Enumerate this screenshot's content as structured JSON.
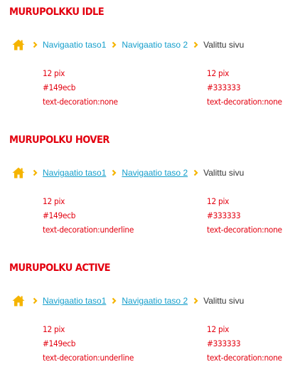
{
  "colors": {
    "title": "#e3000f",
    "link": "#149ecb",
    "current": "#333333",
    "home_icon": "#f5b400",
    "separator": "#f5b400",
    "spec_text": "#e3000f"
  },
  "sections": [
    {
      "title": "MURUPOLKKU IDLE",
      "breadcrumb": {
        "home_icon": "home-icon",
        "separator_icon": "chevron-right-icon",
        "items": [
          "Navigaatio taso1",
          "Navigaatio taso 2"
        ],
        "current": "Valittu sivu"
      },
      "link_spec": [
        "12 pix",
        "#149ecb",
        "text-decoration:none"
      ],
      "current_spec": [
        "12 pix",
        "#333333",
        "text-decoration:none"
      ]
    },
    {
      "title": "MURUPOLKU HOVER",
      "breadcrumb": {
        "home_icon": "home-icon",
        "separator_icon": "chevron-right-icon",
        "items": [
          "Navigaatio taso1",
          "Navigaatio taso 2"
        ],
        "current": "Valittu sivu"
      },
      "link_spec": [
        "12 pix",
        "#149ecb",
        "text-decoration:underline"
      ],
      "current_spec": [
        "12 pix",
        "#333333",
        "text-decoration:none"
      ]
    },
    {
      "title": "MURUPOLKU ACTIVE",
      "breadcrumb": {
        "home_icon": "home-icon",
        "separator_icon": "chevron-right-icon",
        "items": [
          "Navigaatio taso1",
          "Navigaatio taso 2"
        ],
        "current": "Valittu sivu"
      },
      "link_spec": [
        "12 pix",
        "#149ecb",
        "text-decoration:underline"
      ],
      "current_spec": [
        "12 pix",
        "#333333",
        "text-decoration:none"
      ]
    }
  ]
}
